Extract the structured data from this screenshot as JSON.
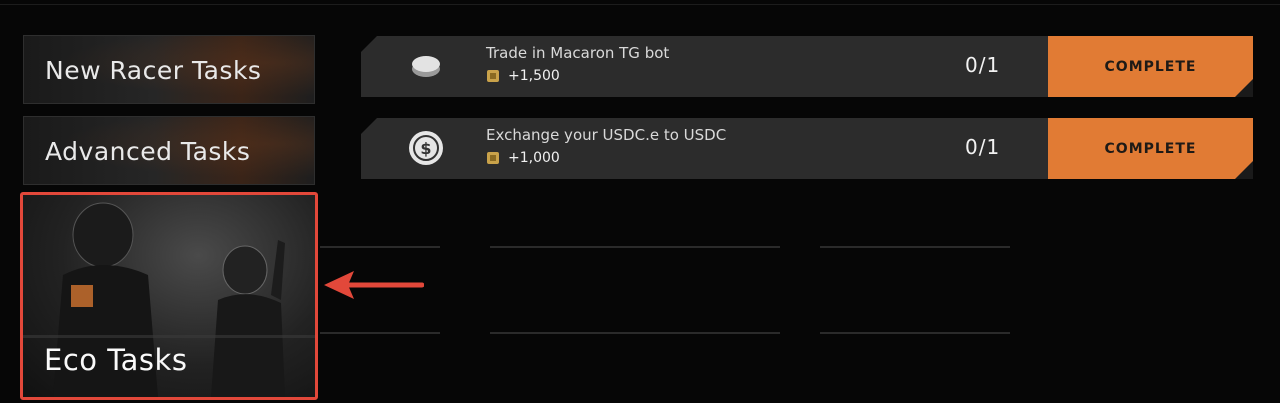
{
  "categories": [
    {
      "label": "New Racer Tasks"
    },
    {
      "label": "Advanced Tasks"
    },
    {
      "label": "Eco Tasks"
    }
  ],
  "tasks": [
    {
      "title": "Trade in Macaron TG bot",
      "reward": "+1,500",
      "progress": "0/1",
      "button": "COMPLETE",
      "icon": "token-coin-icon"
    },
    {
      "title": "Exchange your USDC.e to USDC",
      "reward": "+1,000",
      "progress": "0/1",
      "button": "COMPLETE",
      "icon": "usdc-icon"
    }
  ],
  "colors": {
    "accent": "#e17b34",
    "highlight": "#e2483a",
    "row_bg": "#2c2c2c",
    "background": "#060606"
  }
}
